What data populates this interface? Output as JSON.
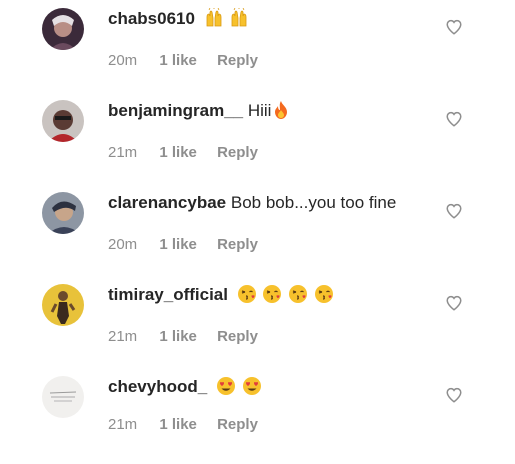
{
  "comments": [
    {
      "username": "chabs0610",
      "text": "",
      "emoji": [
        "raising-hands-emoji",
        "raising-hands-emoji"
      ],
      "time": "20m",
      "likes": "1 like",
      "reply": "Reply"
    },
    {
      "username": "benjamingram__",
      "text": "Hiii",
      "emoji": [
        "fire-emoji"
      ],
      "time": "21m",
      "likes": "1 like",
      "reply": "Reply"
    },
    {
      "username": "clarenancybae",
      "text": "Bob bob...you too fine",
      "emoji": [],
      "time": "20m",
      "likes": "1 like",
      "reply": "Reply"
    },
    {
      "username": "timiray_official",
      "text": "",
      "emoji": [
        "kiss-face-emoji",
        "kiss-face-emoji",
        "kiss-face-emoji",
        "kiss-face-emoji"
      ],
      "time": "21m",
      "likes": "1 like",
      "reply": "Reply"
    },
    {
      "username": "chevyhood_",
      "text": "",
      "emoji": [
        "heart-eyes-emoji",
        "heart-eyes-emoji"
      ],
      "time": "21m",
      "likes": "1 like",
      "reply": "Reply"
    }
  ],
  "colors": {
    "text": "#262626",
    "muted": "#8e8e8e",
    "emoji_yellow": "#f7c12c",
    "emoji_red": "#e23c3c"
  }
}
